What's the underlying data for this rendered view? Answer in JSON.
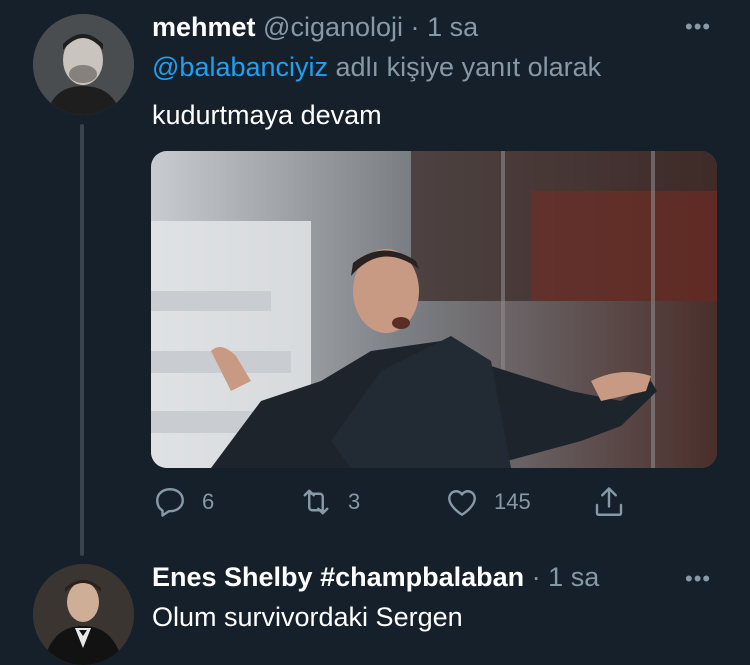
{
  "tweet": {
    "display_name": "mehmet",
    "handle": "@ciganoloji",
    "separator": "·",
    "time": "1 sa",
    "reply_prefix": "@balabanciyiz",
    "reply_suffix": "adlı kişiye yanıt olarak",
    "text": "kudurtmaya devam",
    "actions": {
      "replies": "6",
      "retweets": "3",
      "likes": "145"
    },
    "more_icon": "more-icon"
  },
  "reply": {
    "display_name": "Enes Shelby #champbalaban",
    "separator": "·",
    "time": "1 sa",
    "text": "Olum survivordaki Sergen"
  },
  "colors": {
    "background": "#15202b",
    "muted": "#8899a6",
    "link": "#1da1f2",
    "thread_line": "#38444d"
  }
}
